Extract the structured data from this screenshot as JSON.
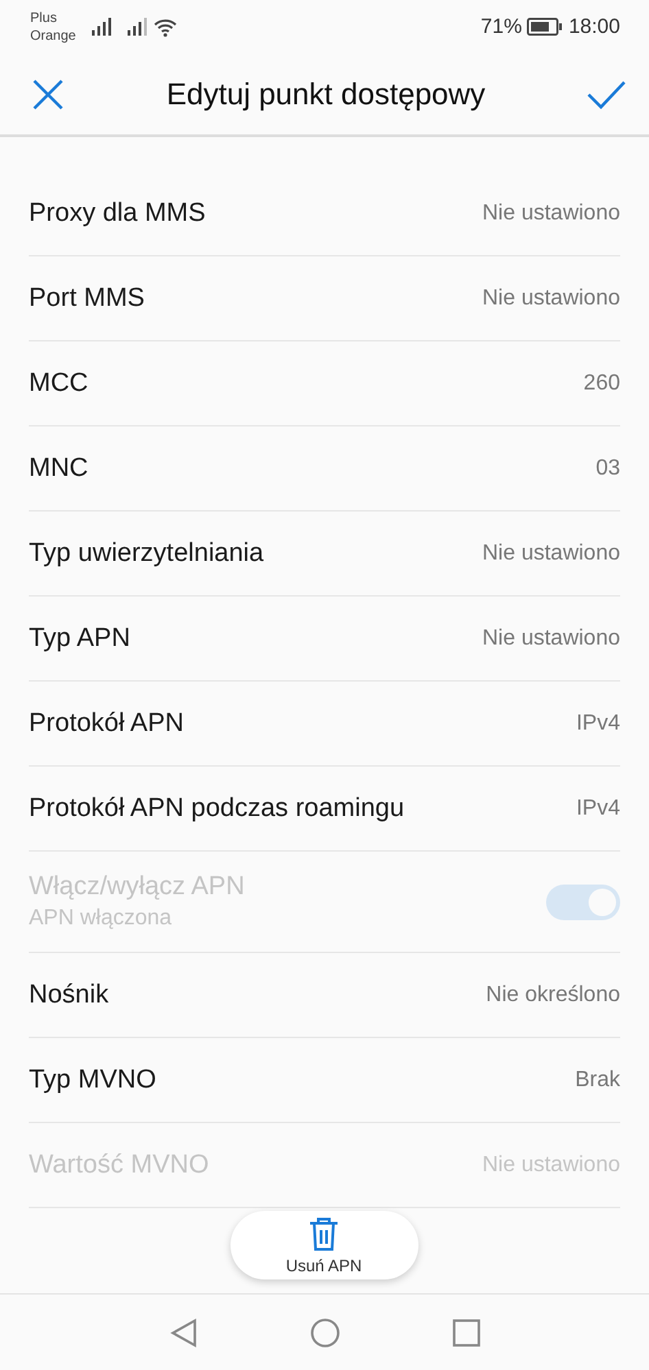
{
  "status_bar": {
    "carrier_1": "Plus",
    "carrier_2": "Orange",
    "battery": "71%",
    "time": "18:00"
  },
  "header": {
    "title": "Edytuj punkt dostępowy"
  },
  "settings": [
    {
      "kind": "value",
      "label": "Proxy dla MMS",
      "value": "Nie ustawiono",
      "disabled": false
    },
    {
      "kind": "value",
      "label": "Port MMS",
      "value": "Nie ustawiono",
      "disabled": false
    },
    {
      "kind": "value",
      "label": "MCC",
      "value": "260",
      "disabled": false
    },
    {
      "kind": "value",
      "label": "MNC",
      "value": "03",
      "disabled": false
    },
    {
      "kind": "value",
      "label": "Typ uwierzytelniania",
      "value": "Nie ustawiono",
      "disabled": false
    },
    {
      "kind": "value",
      "label": "Typ APN",
      "value": "Nie ustawiono",
      "disabled": false
    },
    {
      "kind": "value",
      "label": "Protokół APN",
      "value": "IPv4",
      "disabled": false
    },
    {
      "kind": "value",
      "label": "Protokół APN podczas roamingu",
      "value": "IPv4",
      "disabled": false
    },
    {
      "kind": "switch",
      "label": "Włącz/wyłącz APN",
      "summary": "APN włączona",
      "on": true,
      "disabled": true
    },
    {
      "kind": "value",
      "label": "Nośnik",
      "value": "Nie określono",
      "disabled": false
    },
    {
      "kind": "value",
      "label": "Typ MVNO",
      "value": "Brak",
      "disabled": false
    },
    {
      "kind": "value",
      "label": "Wartość MVNO",
      "value": "Nie ustawiono",
      "disabled": true
    }
  ],
  "delete_button": {
    "label": "Usuń APN"
  }
}
